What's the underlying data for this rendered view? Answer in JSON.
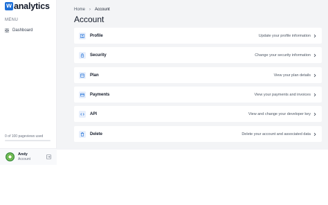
{
  "brand": {
    "mark": "w",
    "name": "analytics",
    "accent": "#1d6fd8"
  },
  "sidebar": {
    "menu_heading": "MENU",
    "items": [
      {
        "label": "Dashboard",
        "icon": "grid-icon"
      }
    ],
    "usage": {
      "text": "0 of 100 pageviews used",
      "used": 0,
      "limit": 100
    },
    "user": {
      "name": "Andy",
      "role": "Account"
    }
  },
  "breadcrumb": {
    "home": "Home",
    "current": "Account"
  },
  "page": {
    "title": "Account"
  },
  "cards": [
    {
      "title": "Profile",
      "desc": "Update your profile information",
      "icon": "user-icon"
    },
    {
      "title": "Security",
      "desc": "Change your security information",
      "icon": "lock-icon"
    },
    {
      "title": "Plan",
      "desc": "View your plan details",
      "icon": "calendar-icon"
    },
    {
      "title": "Payments",
      "desc": "View your payments and invoices",
      "icon": "credit-card-icon"
    },
    {
      "title": "API",
      "desc": "View and change your developer key",
      "icon": "code-icon"
    },
    {
      "title": "Delete",
      "desc": "Delete your account and associated data",
      "icon": "trash-icon"
    }
  ]
}
